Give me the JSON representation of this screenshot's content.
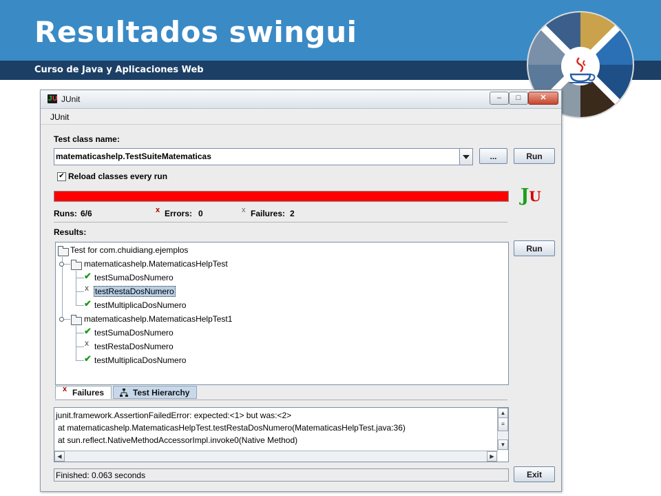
{
  "slide": {
    "title": "Resultados swingui",
    "subtitle": "Curso de Java y Aplicaciones Web"
  },
  "window": {
    "title": "JUnit",
    "menu": [
      "JUnit"
    ],
    "controls": [
      "minimize",
      "maximize",
      "close"
    ]
  },
  "runner": {
    "test_class_label": "Test class name:",
    "test_class_value": "matematicashelp.TestSuiteMatematicas",
    "browse_label": "...",
    "run_label": "Run",
    "reload_label": "Reload classes every run",
    "reload_checked": true,
    "progress_status": "failed",
    "progress_color": "#ff0000",
    "runs_label": "Runs:",
    "runs_value": "6/6",
    "errors_label": "Errors:",
    "errors_value": "0",
    "failures_label": "Failures:",
    "failures_value": "2",
    "results_label": "Results:",
    "run_tree_label": "Run",
    "exit_label": "Exit"
  },
  "tree": {
    "root": "Test for com.chuidiang.ejemplos",
    "suites": [
      {
        "name": "matematicashelp.MatematicasHelpTest",
        "tests": [
          {
            "name": "testSumaDosNumero",
            "status": "pass"
          },
          {
            "name": "testRestaDosNumero",
            "status": "fail",
            "selected": true
          },
          {
            "name": "testMultiplicaDosNumero",
            "status": "pass"
          }
        ]
      },
      {
        "name": "matematicashelp.MatematicasHelpTest1",
        "tests": [
          {
            "name": "testSumaDosNumero",
            "status": "pass"
          },
          {
            "name": "testRestaDosNumero",
            "status": "fail"
          },
          {
            "name": "testMultiplicaDosNumero",
            "status": "pass"
          }
        ]
      }
    ]
  },
  "tabs": [
    {
      "label": "Failures",
      "active": true
    },
    {
      "label": "Test Hierarchy",
      "active": false
    }
  ],
  "trace": [
    "junit.framework.AssertionFailedError: expected:<1> but was:<2>",
    "at matematicashelp.MatematicasHelpTest.testRestaDosNumero(MatematicasHelpTest.java:36)",
    "at sun.reflect.NativeMethodAccessorImpl.invoke0(Native Method)"
  ],
  "status": "Finished: 0.063 seconds"
}
